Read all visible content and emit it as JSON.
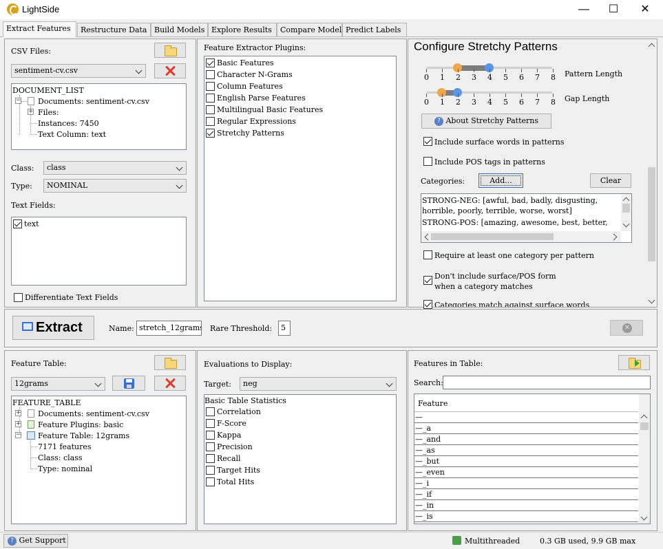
{
  "window": {
    "title": "LightSide",
    "minimize": "—",
    "maximize": "☐",
    "close": "✕"
  },
  "tabs": [
    "Extract Features",
    "Restructure Data",
    "Build Models",
    "Explore Results",
    "Compare Models",
    "Predict Labels"
  ],
  "csv": {
    "label": "CSV Files:",
    "selected": "sentiment-cv.csv",
    "tree_root": "DOCUMENT_LIST",
    "tree": [
      "Documents: sentiment-cv.csv",
      "Files:",
      "Instances: 7450",
      "Text Column: text"
    ],
    "class_label": "Class:",
    "class_value": "class",
    "type_label": "Type:",
    "type_value": "NOMINAL",
    "text_fields_label": "Text Fields:",
    "text_fields": [
      "text"
    ],
    "differentiate_label": "Differentiate Text Fields"
  },
  "plugins": {
    "label": "Feature Extractor Plugins:",
    "items": [
      {
        "name": "Basic Features",
        "checked": true
      },
      {
        "name": "Character N-Grams",
        "checked": false
      },
      {
        "name": "Column Features",
        "checked": false
      },
      {
        "name": "English Parse Features",
        "checked": false
      },
      {
        "name": "Multilingual Basic Features",
        "checked": false
      },
      {
        "name": "Regular Expressions",
        "checked": false
      },
      {
        "name": "Stretchy Patterns",
        "checked": true
      }
    ]
  },
  "stretchy": {
    "title": "Configure Stretchy Patterns",
    "scale": [
      "0",
      "1",
      "2",
      "3",
      "4",
      "5",
      "6",
      "7",
      "8"
    ],
    "pattern_length_label": "Pattern Length",
    "pattern_length_range": [
      2,
      4
    ],
    "gap_length_label": "Gap Length",
    "gap_length_range": [
      1,
      2
    ],
    "about_button": "About Stretchy Patterns",
    "include_surface": "Include surface words in patterns",
    "include_surface_checked": true,
    "include_pos": "Include POS tags in patterns",
    "include_pos_checked": false,
    "categories_label": "Categories:",
    "add_button": "Add...",
    "clear_button": "Clear",
    "categories_text": [
      "STRONG-NEG: [awful, bad, badly, disgusting,",
      "horrible, poorly, terrible, worse, worst]",
      "STRONG-POS: [amazing, awesome, best, better,"
    ],
    "require_one": "Require at least one category per pattern",
    "require_one_checked": false,
    "dont_include_1": "Don't include surface/POS form",
    "dont_include_2": "when a category matches",
    "dont_include_checked": true,
    "match_surface": "Categories match against surface words",
    "match_surface_checked": true
  },
  "extract": {
    "button": "Extract",
    "name_label": "Name:",
    "name_value": "stretch_12grams",
    "threshold_label": "Rare Threshold:",
    "threshold_value": "5"
  },
  "feature_table": {
    "label": "Feature Table:",
    "selected": "12grams",
    "tree_root": "FEATURE_TABLE",
    "tree": [
      "Documents: sentiment-cv.csv",
      "Feature Plugins: basic",
      "Feature Table: 12grams",
      "7171 features",
      "Class: class",
      "Type: nominal"
    ]
  },
  "evaluations": {
    "label": "Evaluations to Display:",
    "target_label": "Target:",
    "target_value": "neg",
    "header": "Basic Table Statistics",
    "items": [
      "Correlation",
      "F-Score",
      "Kappa",
      "Precision",
      "Recall",
      "Target Hits",
      "Total Hits"
    ]
  },
  "features": {
    "label": "Features in Table:",
    "search_label": "Search:",
    "column": "Feature",
    "rows": [
      "—",
      "—_a",
      "—_and",
      "—_as",
      "—_but",
      "—_even",
      "—_i",
      "—_if",
      "—_in",
      "—_is"
    ]
  },
  "status": {
    "support": "Get Support",
    "threading": "Multithreaded",
    "memory": "0.3 GB used, 9.9 GB max"
  },
  "colors": {
    "knob_left": "#f0a64a",
    "knob_right": "#5a95e6",
    "accent": "#d7a21d"
  }
}
